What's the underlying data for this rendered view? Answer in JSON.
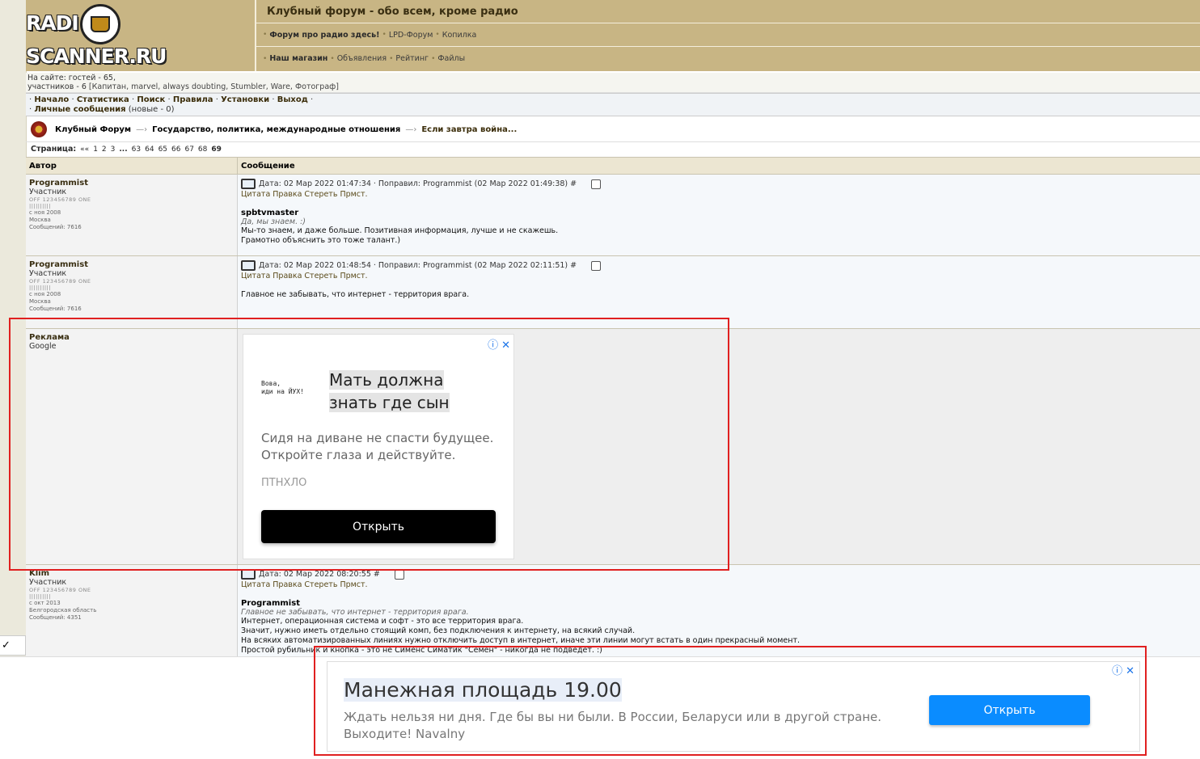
{
  "header": {
    "logo_text": "RADIO SCANNER.RU",
    "title": "Клубный форум - обо всем, кроме радио",
    "links_row1": [
      "Форум про радио здесь!",
      "LPD-Форум",
      "Копилка"
    ],
    "links_row2": [
      "Наш магазин",
      "Объявления",
      "Рейтинг",
      "Файлы"
    ]
  },
  "online": {
    "line1": "На сайте: гостей - 65,",
    "line2_prefix": "участников - 6",
    "line2_names": "[Капитан, marvel, always doubting, Stumbler, Ware, Фотограф]"
  },
  "nav": {
    "items": [
      "Начало",
      "Статистика",
      "Поиск",
      "Правила",
      "Установки",
      "Выход"
    ],
    "pm_label": "Личные сообщения",
    "pm_count": "(новые - 0)"
  },
  "breadcrumb": [
    "Клубный Форум",
    "Государство, политика, международные отношения",
    "Если завтра война..."
  ],
  "pagination": {
    "label": "Страница:",
    "prev": "««",
    "pages": [
      "1",
      "2",
      "3",
      "...",
      "63",
      "64",
      "65",
      "66",
      "67",
      "68",
      "69"
    ],
    "current": "69"
  },
  "table": {
    "col_author": "Автор",
    "col_message": "Сообщение"
  },
  "posts": [
    {
      "author": "Programmist",
      "role": "Участник",
      "rank": "OFF 123456789 ONE",
      "rank2": "||||||||||",
      "since": "с ноя 2008",
      "city": "Москва",
      "msgs": "Сообщений: 7616",
      "date": "Дата: 02 Мар 2022 01:47:34 · Поправил: Programmist (02 Мар 2022 01:49:38) #",
      "actions": [
        "Цитата",
        "Правка",
        "Стереть",
        "Прмст."
      ],
      "quote_author": "spbtvmaster",
      "quote": "Да, мы знаем. :)",
      "lines": [
        "Мы-то знаем, и даже больше. Позитивная информация, лучше и не скажешь.",
        "Грамотно объяснить это тоже талант.)"
      ]
    },
    {
      "author": "Programmist",
      "role": "Участник",
      "rank": "OFF 123456789 ONE",
      "rank2": "||||||||||",
      "since": "с ноя 2008",
      "city": "Москва",
      "msgs": "Сообщений: 7616",
      "date": "Дата: 02 Мар 2022 01:48:54 · Поправил: Programmist (02 Мар 2022 02:11:51) #",
      "actions": [
        "Цитата",
        "Правка",
        "Стереть",
        "Прмст."
      ],
      "lines": [
        "Главное не забывать, что интернет - территория врага."
      ]
    },
    {
      "author": "Klim",
      "role": "Участник",
      "rank": "OFF 123456789 ONE",
      "rank2": "||||||||||",
      "since": "с окт 2013",
      "city": "Белгородская область",
      "msgs": "Сообщений: 4351",
      "date": "Дата: 02 Мар 2022 08:20:55 #",
      "actions": [
        "Цитата",
        "Правка",
        "Стереть",
        "Прмст."
      ],
      "quote_author": "Programmist",
      "quote": "Главное не забывать, что интернет - территория врага.",
      "lines": [
        "Интернет, операционная система и софт - это все территория врага.",
        "Значит, нужно иметь отдельно стоящий комп, без подключения к интернету, на всякий случай.",
        "На всяких автоматизированных линиях нужно отключить доступ в интернет, иначе эти линии могут встать в один прекрасный момент.",
        "Простой рубильник и кнопка - это не Сименс Симатик \"Семен\" - никогда не подведет. :)"
      ]
    }
  ],
  "ad_post": {
    "author": "Реклама",
    "source": "Google",
    "thumb_line1": "Вова,",
    "thumb_line2": "иди  на  ЙУХ!",
    "headline1": "Мать должна",
    "headline2": "знать где сын",
    "description": "Сидя на диване не спасти будущее. Откройте глаза и действуйте.",
    "advertiser": "ПТНХЛО",
    "button": "Открыть"
  },
  "bottom_ad": {
    "headline": "Манежная площадь 19.00",
    "description": "Ждать нельзя ни дня. Где бы вы ни были. В России, Беларуси или в другой стране. Выходите! Navalny",
    "button": "Открыть"
  },
  "ad_controls": {
    "info": "ⓘ",
    "close": "✕"
  },
  "side_tab": "✓"
}
